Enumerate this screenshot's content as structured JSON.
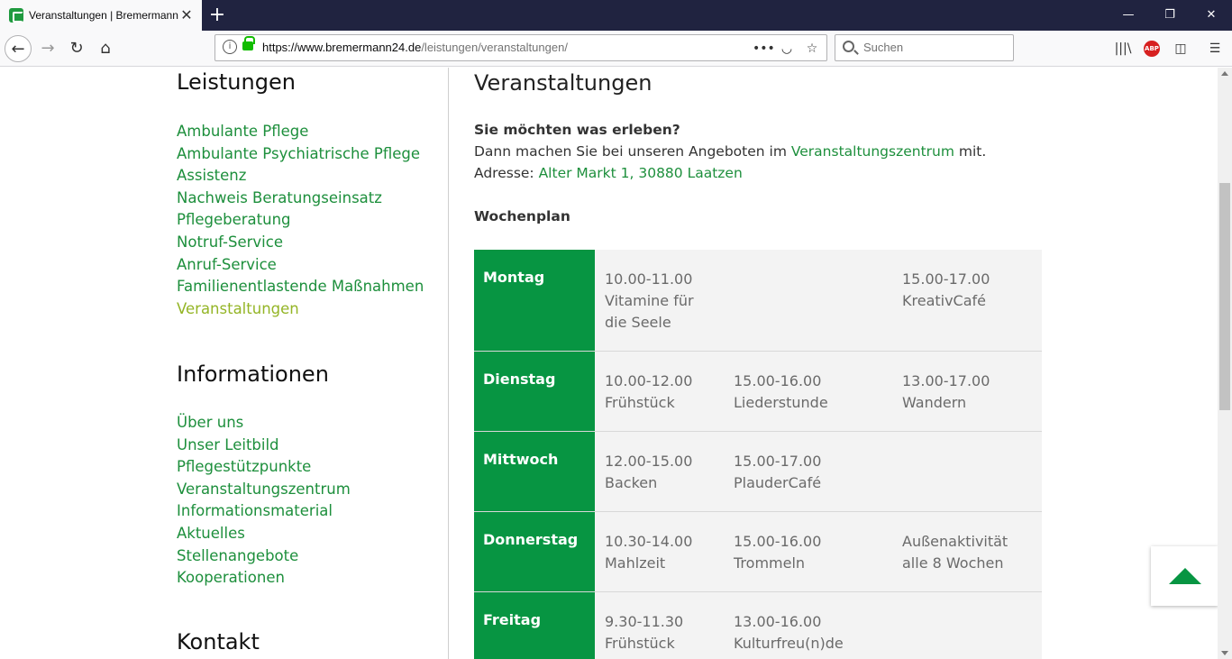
{
  "browser": {
    "tab_title": "Veranstaltungen | Bremermann",
    "url_domain": "https://www.bremermann24.de",
    "url_path": "/leistungen/veranstaltungen/",
    "search_placeholder": "Suchen"
  },
  "sidebar": {
    "leistungen_heading": "Leistungen",
    "leistungen": [
      "Ambulante Pflege",
      "Ambulante Psychiatrische Pflege",
      "Assistenz",
      "Nachweis Beratungseinsatz",
      "Pflegeberatung",
      "Notruf-Service",
      "Anruf-Service",
      "Familienentlastende Maßnahmen",
      "Veranstaltungen"
    ],
    "informationen_heading": "Informationen",
    "informationen": [
      "Über uns",
      "Unser Leitbild",
      "Pflegestützpunkte",
      "Veranstaltungszentrum",
      "Informationsmaterial",
      "Aktuelles",
      "Stellenangebote",
      "Kooperationen"
    ],
    "kontakt_heading": "Kontakt"
  },
  "main": {
    "title": "Veranstaltungen",
    "question": "Sie möchten was erleben?",
    "line1_pre": "Dann machen Sie bei unseren Angeboten im ",
    "line1_link": "Veranstaltungszentrum",
    "line1_post": " mit.",
    "line2_pre": "Adresse: ",
    "line2_link": "Alter Markt 1, 30880 Laatzen",
    "wochenplan": "Wochenplan"
  },
  "schedule": [
    {
      "day": "Montag",
      "c1": [
        "10.00-11.00",
        "Vitamine für",
        "die Seele"
      ],
      "c2": [],
      "c3": [
        "15.00-17.00",
        "KreativCafé"
      ]
    },
    {
      "day": "Dienstag",
      "c1": [
        "10.00-12.00",
        "Frühstück"
      ],
      "c2": [
        "15.00-16.00",
        "Liederstunde"
      ],
      "c3": [
        "13.00-17.00",
        "Wandern"
      ]
    },
    {
      "day": "Mittwoch",
      "c1": [
        "12.00-15.00",
        "Backen"
      ],
      "c2": [
        "15.00-17.00",
        "PlauderCafé"
      ],
      "c3": []
    },
    {
      "day": "Donnerstag",
      "c1": [
        "10.30-14.00",
        "Mahlzeit"
      ],
      "c2": [
        "15.00-16.00",
        "Trommeln"
      ],
      "c3": [
        "Außenaktivität",
        "alle 8 Wochen"
      ]
    },
    {
      "day": "Freitag",
      "c1": [
        "9.30-11.30",
        "Frühstück"
      ],
      "c2": [
        "13.00-16.00",
        "Kulturfreu(n)de"
      ],
      "c3": []
    }
  ],
  "colors": {
    "accent": "#079542",
    "link": "#1d8f3c",
    "active_link": "#94b526"
  }
}
